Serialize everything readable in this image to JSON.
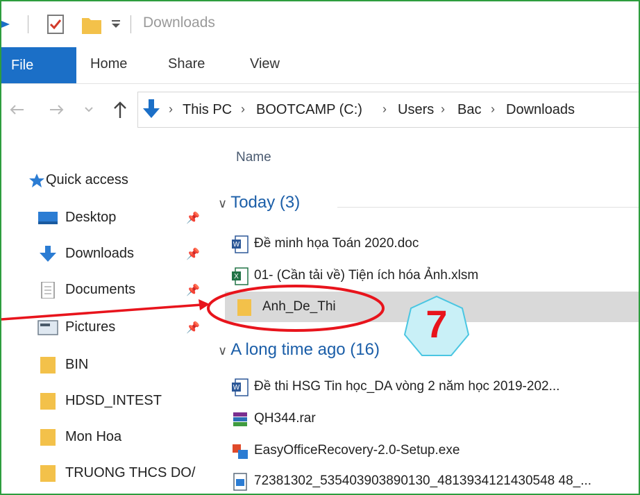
{
  "window": {
    "title": "Downloads"
  },
  "ribbon": {
    "tabs": [
      "File",
      "Home",
      "Share",
      "View"
    ]
  },
  "breadcrumb": [
    "This PC",
    "BOOTCAMP (C:)",
    "Users",
    "Bac",
    "Downloads"
  ],
  "navigation": {
    "quick_access": "Quick access",
    "items": [
      {
        "label": "Desktop",
        "pinned": true,
        "icon": "desktop-icon"
      },
      {
        "label": "Downloads",
        "pinned": true,
        "icon": "download-arrow-icon"
      },
      {
        "label": "Documents",
        "pinned": true,
        "icon": "document-icon"
      },
      {
        "label": "Pictures",
        "pinned": true,
        "icon": "picture-icon"
      },
      {
        "label": "BIN",
        "pinned": false,
        "icon": "folder-icon"
      },
      {
        "label": "HDSD_INTEST",
        "pinned": false,
        "icon": "folder-icon"
      },
      {
        "label": "Mon Hoa",
        "pinned": false,
        "icon": "folder-icon"
      },
      {
        "label": "TRUONG THCS DO/",
        "pinned": false,
        "icon": "folder-icon"
      }
    ]
  },
  "file_list": {
    "column_name": "Name",
    "groups": [
      {
        "label": "Today (3)",
        "files": [
          {
            "name": "Đề minh họa Toán 2020.doc",
            "icon": "word-icon"
          },
          {
            "name": "01- (Cần tải về) Tiện ích hóa Ảnh.xlsm",
            "icon": "excel-icon"
          },
          {
            "name": "Anh_De_Thi",
            "icon": "folder-icon",
            "selected": true
          }
        ]
      },
      {
        "label": "A long time ago (16)",
        "files": [
          {
            "name": "Đề thi HSG Tin học_DA vòng 2 năm học 2019-202...",
            "icon": "word-icon"
          },
          {
            "name": "QH344.rar",
            "icon": "rar-archive-icon"
          },
          {
            "name": "EasyOfficeRecovery-2.0-Setup.exe",
            "icon": "installer-icon"
          },
          {
            "name": "72381302_535403903890130_4813934121430548 48_...",
            "icon": "image-file-icon"
          }
        ]
      }
    ]
  },
  "annotation": {
    "step": "7"
  },
  "colors": {
    "accent": "#1b6fc7",
    "frame": "#2e9d3e",
    "annotation_red": "#e8141c",
    "badge_fill": "#c9f0f7"
  }
}
